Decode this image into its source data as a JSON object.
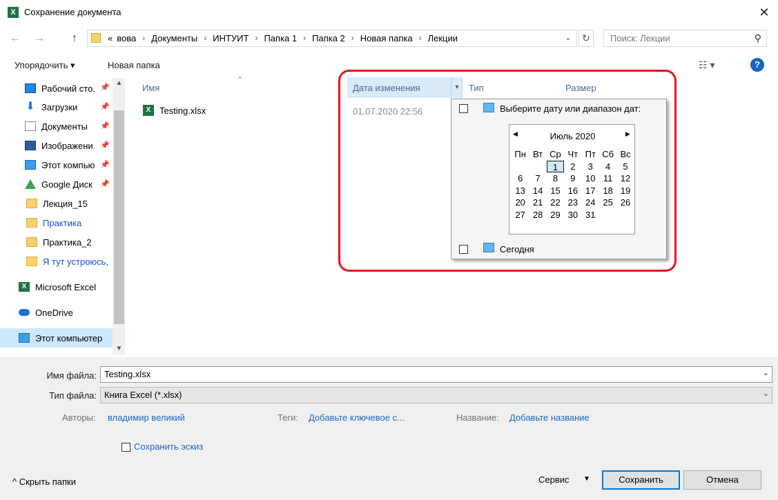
{
  "window": {
    "title": "Сохранение документа",
    "app_icon_letter": "X",
    "close_glyph": "✕"
  },
  "address_bar": {
    "back_glyph": "←",
    "forward_glyph": "→",
    "up_glyph": "↑",
    "overflow": "«",
    "breadcrumbs": [
      "вова",
      "Документы",
      "ИНТУИТ",
      "Папка 1",
      "Папка 2",
      "Новая папка",
      "Лекции"
    ],
    "separator": "›",
    "dropdown_glyph": "⌄",
    "refresh_glyph": "↻"
  },
  "search": {
    "placeholder": "Поиск: Лекции",
    "icon": "search-icon",
    "glyph": "⚲"
  },
  "toolbar": {
    "organize_label": "Упорядочить ▾",
    "new_folder_label": "Новая папка",
    "view_glyph": "☷ ▾",
    "help_glyph": "?"
  },
  "nav_pane": {
    "pin_glyph": "📌",
    "items": [
      {
        "label": "Рабочий сто.",
        "icon": "desktop-icon",
        "pinned": true
      },
      {
        "label": "Загрузки",
        "icon": "download-icon",
        "pinned": true,
        "glyph": "⬇"
      },
      {
        "label": "Документы",
        "icon": "documents-icon",
        "pinned": true
      },
      {
        "label": "Изображени",
        "icon": "pictures-icon",
        "pinned": true
      },
      {
        "label": "Этот компью",
        "icon": "computer-icon",
        "pinned": true
      },
      {
        "label": "Google Диск",
        "icon": "google-drive-icon",
        "pinned": true
      },
      {
        "label": "Лекция_15",
        "icon": "folder-icon"
      },
      {
        "label": "Практика",
        "icon": "folder-icon"
      },
      {
        "label": "Практика_2",
        "icon": "folder-icon"
      },
      {
        "label": "Я тут устроюсь,",
        "icon": "folder-icon"
      },
      {
        "label": "Microsoft Excel",
        "icon": "excel-icon",
        "glyph": "X"
      },
      {
        "label": "OneDrive",
        "icon": "onedrive-icon"
      },
      {
        "label": "Этот компьютер",
        "icon": "computer-icon",
        "selected": true
      }
    ],
    "scroll_up_glyph": "▲",
    "scroll_down_glyph": "▼"
  },
  "file_list": {
    "sort_glyph": "^",
    "columns": {
      "name": "Имя",
      "date": "Дата изменения",
      "type": "Тип",
      "size": "Размер"
    },
    "date_dropdown_glyph": "▾",
    "files": [
      {
        "name": "Testing.xlsx",
        "date": "01.07.2020 22:56",
        "icon_letter": "X"
      }
    ]
  },
  "date_filter": {
    "prompt": "Выберите дату или диапазон дат:",
    "today": "Сегодня",
    "calendar": {
      "month_label": "Июль 2020",
      "prev_glyph": "◀",
      "next_glyph": "▶",
      "weekdays": [
        "Пн",
        "Вт",
        "Ср",
        "Чт",
        "Пт",
        "Сб",
        "Вс"
      ],
      "days": [
        "",
        "",
        "1",
        "2",
        "3",
        "4",
        "5",
        "6",
        "7",
        "8",
        "9",
        "10",
        "11",
        "12",
        "13",
        "14",
        "15",
        "16",
        "17",
        "18",
        "19",
        "20",
        "21",
        "22",
        "23",
        "24",
        "25",
        "26",
        "27",
        "28",
        "29",
        "30",
        "31",
        "",
        "",
        ""
      ],
      "selected_day": "1"
    }
  },
  "details": {
    "filename_label": "Имя файла:",
    "filename_value": "Testing.xlsx",
    "filetype_label": "Тип файла:",
    "filetype_value": "Книга Excel (*.xlsx)",
    "dropdown_glyph": "⌄",
    "authors_label": "Авторы:",
    "authors_value": "владимир великий",
    "tags_label": "Теги:",
    "tags_value": "Добавьте ключевое с...",
    "title_label": "Название:",
    "title_value": "Добавьте название",
    "thumbnail_label": "Сохранить эскиз"
  },
  "footer": {
    "hide_folders": "^  Скрыть папки",
    "service": "Сервис",
    "service_caret": "▼",
    "save": "Сохранить",
    "cancel": "Отмена"
  },
  "colors": {
    "highlight": "#e8121b",
    "accent": "#0078d7",
    "link": "#1a64c8"
  }
}
